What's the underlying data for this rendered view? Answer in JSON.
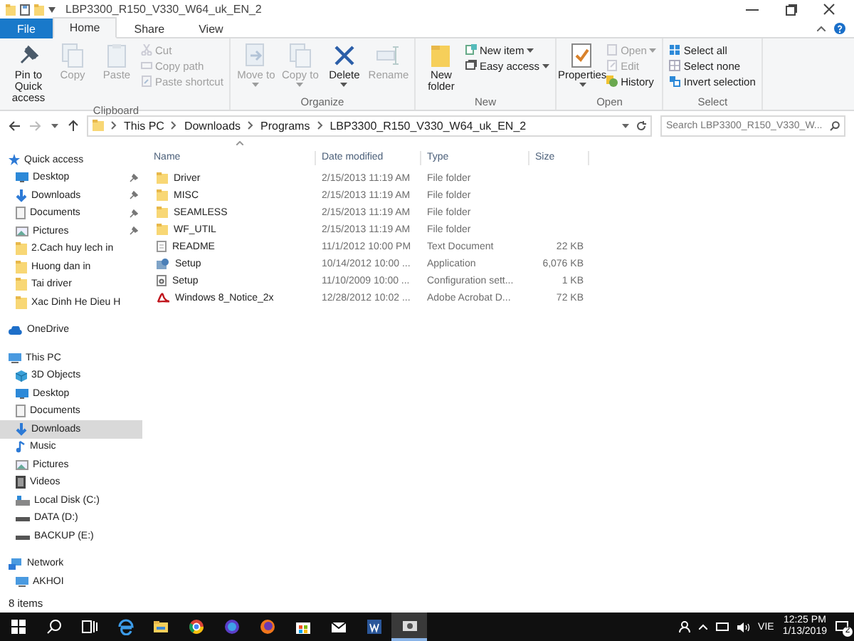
{
  "window": {
    "title": "LBP3300_R150_V330_W64_uk_EN_2"
  },
  "tabs": [
    {
      "label": "File",
      "kind": "file",
      "selected": false
    },
    {
      "label": "Home",
      "kind": "tab",
      "selected": true
    },
    {
      "label": "Share",
      "kind": "tab",
      "selected": false
    },
    {
      "label": "View",
      "kind": "tab",
      "selected": false
    }
  ],
  "ribbon": {
    "groups": [
      {
        "label": "Clipboard",
        "buttons": [
          {
            "label": "Pin to Quick access",
            "kind": "large",
            "disabled": false,
            "dropdown": false
          },
          {
            "label": "Copy",
            "kind": "large",
            "disabled": true,
            "dropdown": false
          },
          {
            "label": "Paste",
            "kind": "large",
            "disabled": true,
            "dropdown": false
          },
          {
            "label": "Cut",
            "kind": "small",
            "disabled": true,
            "dropdown": false
          },
          {
            "label": "Copy path",
            "kind": "small",
            "disabled": true,
            "dropdown": false
          },
          {
            "label": "Paste shortcut",
            "kind": "small",
            "disabled": true,
            "dropdown": false
          }
        ]
      },
      {
        "label": "Organize",
        "buttons": [
          {
            "label": "Move to",
            "kind": "large",
            "disabled": true,
            "dropdown": true
          },
          {
            "label": "Copy to",
            "kind": "large",
            "disabled": true,
            "dropdown": true
          },
          {
            "label": "Delete",
            "kind": "large",
            "disabled": false,
            "dropdown": true
          },
          {
            "label": "Rename",
            "kind": "large",
            "disabled": true,
            "dropdown": false
          }
        ]
      },
      {
        "label": "New",
        "buttons": [
          {
            "label": "New folder",
            "kind": "large",
            "disabled": false,
            "dropdown": false
          },
          {
            "label": "New item",
            "kind": "small",
            "disabled": false,
            "dropdown": true
          },
          {
            "label": "Easy access",
            "kind": "small",
            "disabled": false,
            "dropdown": true
          }
        ]
      },
      {
        "label": "Open",
        "buttons": [
          {
            "label": "Properties",
            "kind": "large",
            "disabled": false,
            "dropdown": true
          },
          {
            "label": "Open",
            "kind": "small",
            "disabled": true,
            "dropdown": true
          },
          {
            "label": "Edit",
            "kind": "small",
            "disabled": true,
            "dropdown": false
          },
          {
            "label": "History",
            "kind": "small",
            "disabled": false,
            "dropdown": false
          }
        ]
      },
      {
        "label": "Select",
        "buttons": [
          {
            "label": "Select all",
            "kind": "small",
            "disabled": false,
            "dropdown": false
          },
          {
            "label": "Select none",
            "kind": "small",
            "disabled": false,
            "dropdown": false
          },
          {
            "label": "Invert selection",
            "kind": "small",
            "disabled": false,
            "dropdown": false
          }
        ]
      }
    ]
  },
  "address": {
    "crumbs": [
      "This PC",
      "Downloads",
      "Programs",
      "LBP3300_R150_V330_W64_uk_EN_2"
    ],
    "search": {
      "placeholder": "Search LBP3300_R150_V330_W..."
    }
  },
  "sidebar": {
    "items": [
      {
        "label": "Quick access",
        "kind": "star",
        "selected": false,
        "children": [
          {
            "label": "Desktop",
            "kind": "desktop",
            "selected": false,
            "pinned": true
          },
          {
            "label": "Downloads",
            "kind": "downloads",
            "selected": false,
            "pinned": true
          },
          {
            "label": "Documents",
            "kind": "documents",
            "selected": false,
            "pinned": true
          },
          {
            "label": "Pictures",
            "kind": "pictures",
            "selected": false,
            "pinned": true
          },
          {
            "label": "2.Cach huy lech in",
            "kind": "folder",
            "selected": false,
            "pinned": false
          },
          {
            "label": "Huong dan in",
            "kind": "folder",
            "selected": false,
            "pinned": false
          },
          {
            "label": "Tai driver",
            "kind": "folder",
            "selected": false,
            "pinned": false
          },
          {
            "label": "Xac Dinh He Dieu H",
            "kind": "folder",
            "selected": false,
            "pinned": false
          }
        ]
      },
      {
        "label": "OneDrive",
        "kind": "cloud",
        "selected": false
      },
      {
        "label": "This PC",
        "kind": "pc",
        "selected": false,
        "children": [
          {
            "label": "3D Objects",
            "kind": "objects",
            "selected": false
          },
          {
            "label": "Desktop",
            "kind": "desktop",
            "selected": false
          },
          {
            "label": "Documents",
            "kind": "documents",
            "selected": false
          },
          {
            "label": "Downloads",
            "kind": "downloads",
            "selected": true
          },
          {
            "label": "Music",
            "kind": "music",
            "selected": false
          },
          {
            "label": "Pictures",
            "kind": "pictures",
            "selected": false
          },
          {
            "label": "Videos",
            "kind": "videos",
            "selected": false
          },
          {
            "label": "Local Disk (C:)",
            "kind": "system-drive",
            "selected": false
          },
          {
            "label": "DATA (D:)",
            "kind": "drive",
            "selected": false
          },
          {
            "label": "BACKUP (E:)",
            "kind": "drive",
            "selected": false
          }
        ]
      },
      {
        "label": "Network",
        "kind": "network",
        "selected": false,
        "children": [
          {
            "label": "AKHOI",
            "kind": "pc",
            "selected": false
          }
        ]
      }
    ]
  },
  "table": {
    "columns": [
      "Name",
      "Date modified",
      "Type",
      "Size"
    ],
    "rows": [
      {
        "kind": "folder",
        "name": "Driver",
        "date": "2/15/2013 11:19 AM",
        "type": "File folder"
      },
      {
        "kind": "folder",
        "name": "MISC",
        "date": "2/15/2013 11:19 AM",
        "type": "File folder"
      },
      {
        "kind": "folder",
        "name": "SEAMLESS",
        "date": "2/15/2013 11:19 AM",
        "type": "File folder"
      },
      {
        "kind": "folder",
        "name": "WF_UTIL",
        "date": "2/15/2013 11:19 AM",
        "type": "File folder"
      },
      {
        "kind": "text",
        "name": "README",
        "date": "11/1/2012 10:00 PM",
        "type": "Text Document",
        "size": "22 KB"
      },
      {
        "kind": "app",
        "name": "Setup",
        "date": "10/14/2012 10:00 ...",
        "type": "Application",
        "size": "6,076 KB"
      },
      {
        "kind": "config",
        "name": "Setup",
        "date": "11/10/2009 10:00 ...",
        "type": "Configuration sett...",
        "size": "1 KB"
      },
      {
        "kind": "pdf",
        "name": "Windows 8_Notice_2x",
        "date": "12/28/2012 10:02 ...",
        "type": "Adobe Acrobat D...",
        "size": "72 KB"
      }
    ]
  },
  "status_bar": {
    "text": "8 items"
  },
  "taskbar": {
    "language": "VIE",
    "time": "12:25 PM",
    "date": "1/13/2019",
    "notifications": "2"
  }
}
